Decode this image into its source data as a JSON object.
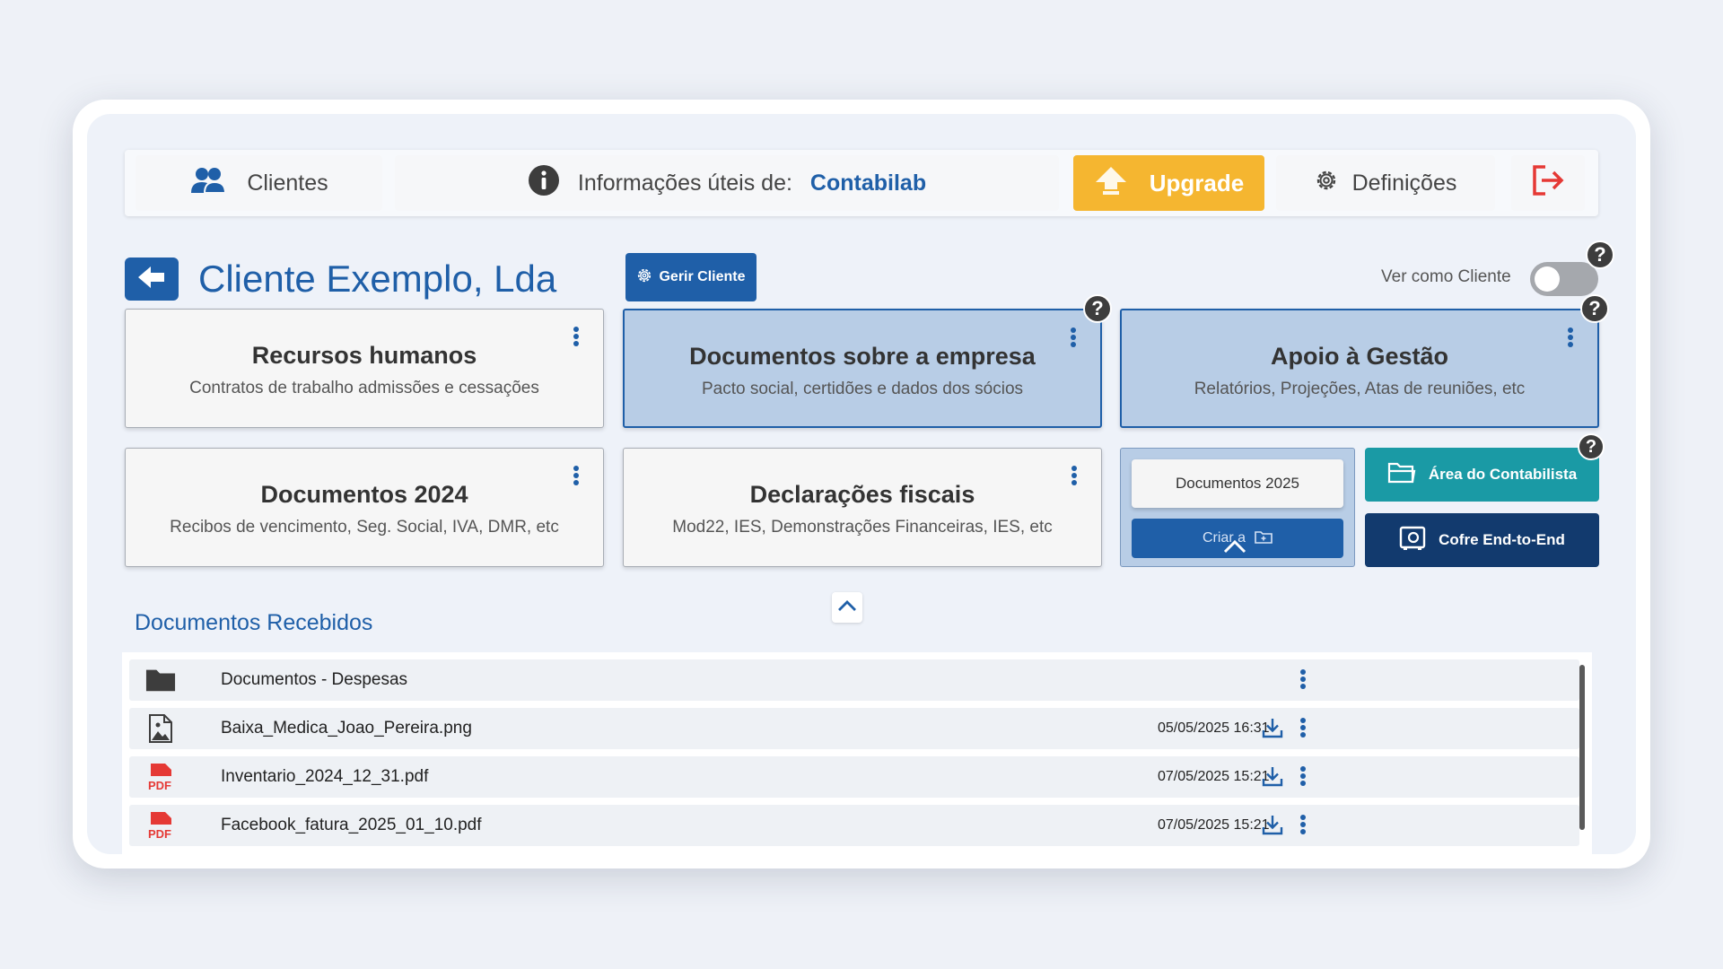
{
  "topbar": {
    "clients_label": "Clientes",
    "info_label": "Informações úteis de:",
    "info_brand": "Contabilab",
    "upgrade_label": "Upgrade",
    "settings_label": "Definições"
  },
  "header": {
    "client_name": "Cliente Exemplo, Lda",
    "manage_label": "Gerir Cliente",
    "view_as_client_label": "Ver como Cliente",
    "view_as_client_on": false
  },
  "cards": [
    {
      "title": "Recursos humanos",
      "subtitle": "Contratos de trabalho admissões e cessações"
    },
    {
      "title": "Documentos sobre a empresa",
      "subtitle": "Pacto social, certidões e dados dos sócios"
    },
    {
      "title": "Apoio à Gestão",
      "subtitle": "Relatórios, Projeções, Atas de reuniões, etc"
    },
    {
      "title": "Documentos 2024",
      "subtitle": "Recibos de vencimento, Seg. Social, IVA, DMR, etc"
    },
    {
      "title": "Declarações fiscais",
      "subtitle": "Mod22, IES, Demonstrações Financeiras, IES, etc"
    }
  ],
  "mini": {
    "docs_label": "Documentos 2025",
    "create_label": "Criar   a"
  },
  "actions": {
    "area_label": "Área do Contabilista",
    "cofre_label": "Cofre End-to-End"
  },
  "received": {
    "title": "Documentos Recebidos",
    "files": [
      {
        "name": "Documentos - Despesas",
        "date": "",
        "type": "folder"
      },
      {
        "name": "Baixa_Medica_Joao_Pereira.png",
        "date": "05/05/2025 16:31",
        "type": "image"
      },
      {
        "name": "Inventario_2024_12_31.pdf",
        "date": "07/05/2025 15:21",
        "type": "pdf"
      },
      {
        "name": "Facebook_fatura_2025_01_10.pdf",
        "date": "07/05/2025 15:21",
        "type": "pdf"
      }
    ]
  },
  "icons": {
    "pdf_text": "PDF",
    "help_text": "?"
  },
  "colors": {
    "primary": "#1f5fa8",
    "upgrade": "#f5b630",
    "teal": "#1a9aa5",
    "navy": "#123a6e",
    "logout": "#e53935",
    "pdf": "#e53935"
  }
}
